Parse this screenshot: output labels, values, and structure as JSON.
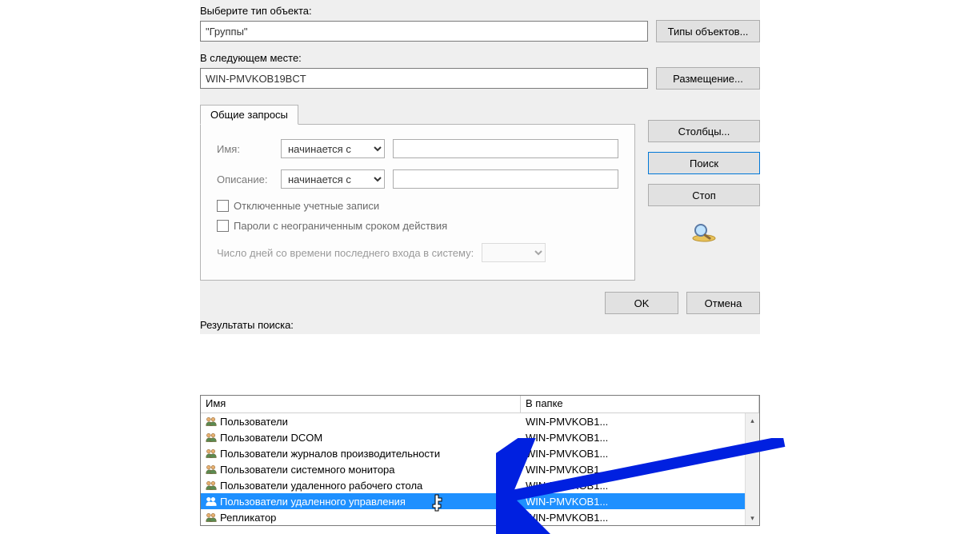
{
  "labels": {
    "select_object_type": "Выберите тип объекта:",
    "object_type_value": "\"Группы\"",
    "btn_object_types": "Типы объектов...",
    "in_location": "В следующем месте:",
    "location_value": "WIN-PMVKOB19BCT",
    "btn_location": "Размещение...",
    "tab_common": "Общие запросы",
    "name": "Имя:",
    "description": "Описание:",
    "starts_with": "начинается с",
    "disabled_accounts": "Отключенные учетные записи",
    "nonexpiring_pw": "Пароли с неограниченным сроком действия",
    "days_since_login": "Число дней со времени последнего входа в систему:",
    "btn_columns": "Столбцы...",
    "btn_find": "Поиск",
    "btn_stop": "Стоп",
    "btn_ok": "OK",
    "btn_cancel": "Отмена",
    "results": "Результаты поиска:",
    "col_name": "Имя",
    "col_folder": "В папке"
  },
  "results_rows": [
    {
      "name": "Пользователи",
      "folder": "WIN-PMVKOB1..."
    },
    {
      "name": "Пользователи DCOM",
      "folder": "WIN-PMVKOB1..."
    },
    {
      "name": "Пользователи журналов производительности",
      "folder": "WIN-PMVKOB1..."
    },
    {
      "name": "Пользователи системного монитора",
      "folder": "WIN-PMVKOB1..."
    },
    {
      "name": "Пользователи удаленного рабочего стола",
      "folder": "WIN-PMVKOB1..."
    },
    {
      "name": "Пользователи удаленного управления",
      "folder": "WIN-PMVKOB1...",
      "selected": true
    },
    {
      "name": "Репликатор",
      "folder": "WIN-PMVKOB1..."
    }
  ]
}
